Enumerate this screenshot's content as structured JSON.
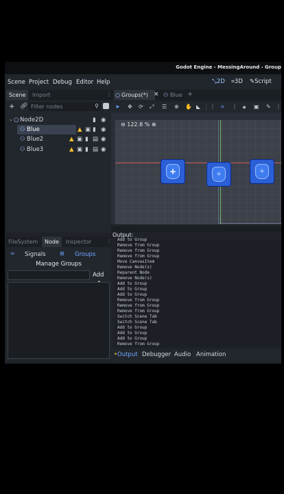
{
  "window": {
    "title": "Godot Engine - MessingAround - Group"
  },
  "menu": {
    "items": [
      "Scene",
      "Project",
      "Debug",
      "Editor",
      "Help"
    ]
  },
  "workspaces": {
    "items": [
      "2D",
      "3D",
      "Script"
    ],
    "active": "2D"
  },
  "scene_dock": {
    "tabs": [
      "Scene",
      "Import"
    ],
    "filter_placeholder": "Filter nodes",
    "root": "Node2D",
    "nodes": [
      "Blue",
      "Blue2",
      "Blue3"
    ],
    "selected": "Blue"
  },
  "editor_tabs": {
    "items": [
      "Groups(*)",
      "Blue"
    ]
  },
  "viewport": {
    "zoom": "122.8 %"
  },
  "bottom_left_tabs": {
    "items": [
      "FileSystem",
      "Node",
      "Inspector"
    ],
    "active": "Node"
  },
  "node_dock": {
    "signals_label": "Signals",
    "groups_label": "Groups",
    "manage_groups_label": "Manage Groups",
    "add_label": "Add",
    "group_name_value": ""
  },
  "output": {
    "label": "Output:",
    "lines": [
      "Add to Group",
      "Remove from Group",
      "Remove from Group",
      "Remove from Group",
      "Move CanvasItem",
      "Remove Node(s)",
      "Reparent Node",
      "Remove Node(s)",
      "Add to Group",
      "Add to Group",
      "Add to Group",
      "Remove from Group",
      "Remove from Group",
      "Remove from Group",
      "Switch Scene Tab",
      "Switch Scene Tab",
      "Add to Group",
      "Add to Group",
      "Add to Group",
      "Remove from Group"
    ],
    "tabs": [
      "Output",
      "Debugger",
      "Audio",
      "Animation"
    ],
    "active_tab": "Output"
  },
  "colors": {
    "accent": "#6fa8ff",
    "sprite_blue": "#2a5fd6",
    "warning": "#f5c033"
  }
}
